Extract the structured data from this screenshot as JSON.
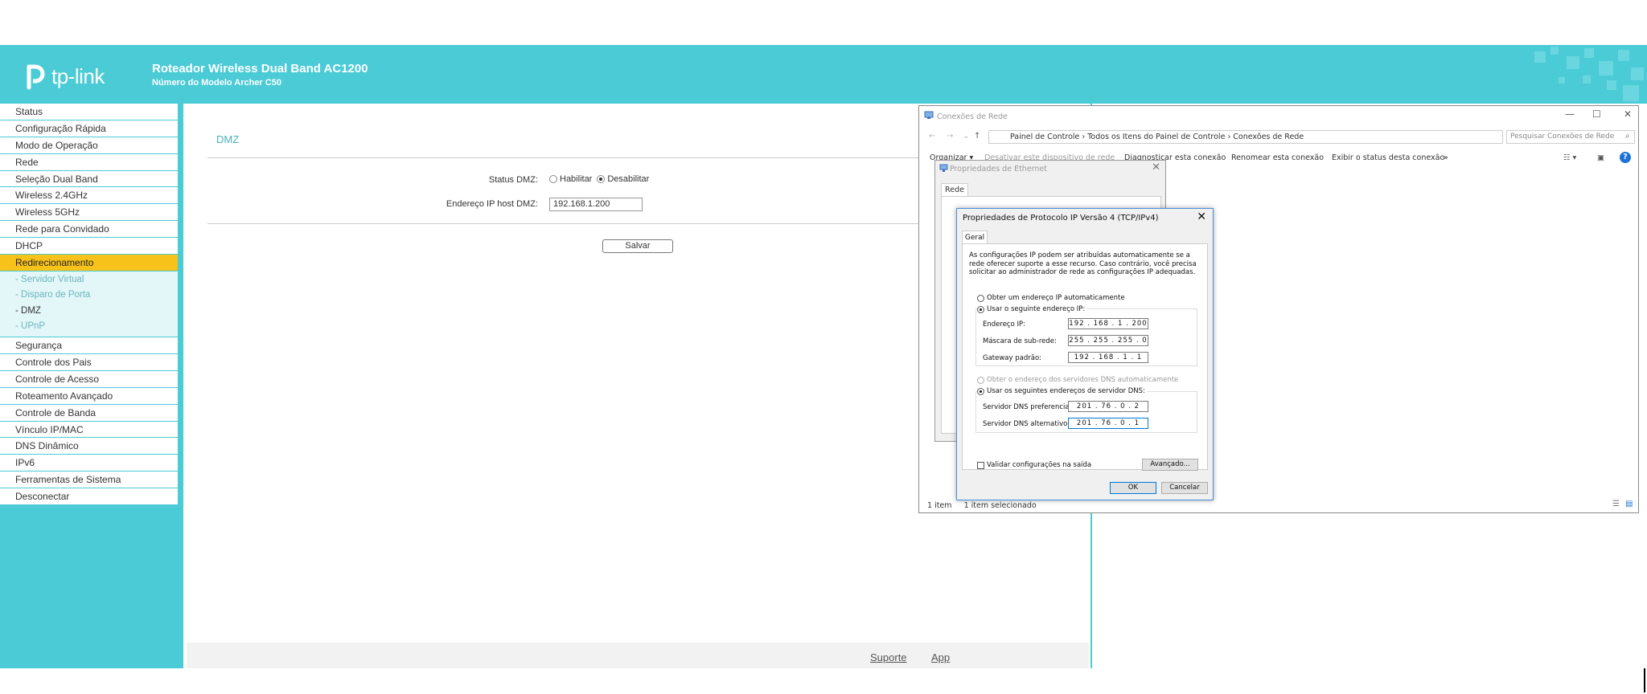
{
  "header": {
    "logo_text": "tp-link",
    "title": "Roteador Wireless Dual Band AC1200",
    "model": "Número do Modelo Archer C50"
  },
  "sidebar": {
    "items": [
      "Status",
      "Configuração Rápida",
      "Modo de Operação",
      "Rede",
      "Seleção Dual Band",
      "Wireless 2.4GHz",
      "Wireless 5GHz",
      "Rede para Convidado",
      "DHCP",
      "Redirecionamento",
      "Segurança",
      "Controle dos Pais",
      "Controle de Acesso",
      "Roteamento Avançado",
      "Controle de Banda",
      "Vínculo IP/MAC",
      "DNS Dinâmico",
      "IPv6",
      "Ferramentas de Sistema",
      "Desconectar"
    ],
    "active": "Redirecionamento",
    "sub_items": [
      "- Servidor Virtual",
      "- Disparo de Porta",
      "- DMZ",
      "- UPnP"
    ],
    "current_sub": "- DMZ"
  },
  "main": {
    "title": "DMZ",
    "status_label": "Status DMZ:",
    "enable_label": "Habilitar",
    "disable_label": "Desabilitar",
    "selected_status": "Desabilitar",
    "host_ip_label": "Endereço IP host DMZ:",
    "host_ip_value": "192.168.1.200",
    "save_label": "Salvar"
  },
  "footer": {
    "support": "Suporte",
    "app": "App"
  },
  "explorer": {
    "title": "Conexões de Rede",
    "breadcrumb": [
      "Painel de Controle",
      "Todos os Itens do Painel de Controle",
      "Conexões de Rede"
    ],
    "search_placeholder": "Pesquisar Conexões de Rede",
    "toolbar": [
      "Organizar ▾",
      "Desativar este dispositivo de rede",
      "Diagnosticar esta conexão",
      "Renomear esta conexão",
      "Exibir o status desta conexão",
      "»"
    ],
    "status_count": "1 item",
    "status_selected": "1 item selecionado"
  },
  "ethernet": {
    "title": "Propriedades de Ethernet",
    "tab": "Rede"
  },
  "ipv4": {
    "title": "Propriedades de Protocolo IP Versão 4 (TCP/IPv4)",
    "tab": "Geral",
    "description": "As configurações IP podem ser atribuídas automaticamente se a rede oferecer suporte a esse recurso. Caso contrário, você precisa solicitar ao administrador de rede as configurações IP adequadas.",
    "auto_ip": "Obter um endereço IP automaticamente",
    "manual_ip": "Usar o seguinte endereço IP:",
    "ip_label": "Endereço IP:",
    "ip_value": "192 . 168 .  1  . 200",
    "mask_label": "Máscara de sub-rede:",
    "mask_value": "255 . 255 . 255 .  0",
    "gateway_label": "Gateway padrão:",
    "gateway_value": "192 . 168 .  1  .  1",
    "auto_dns": "Obter o endereço dos servidores DNS automaticamente",
    "manual_dns": "Usar os seguintes endereços de servidor DNS:",
    "dns1_label": "Servidor DNS preferencial:",
    "dns1_value": "201 .  76  .  0  .  2",
    "dns2_label": "Servidor DNS alternativo:",
    "dns2_value": "201 .  76  .  0  .  1",
    "validate_label": "Validar configurações na saída",
    "advanced_label": "Avançado...",
    "ok_label": "OK",
    "cancel_label": "Cancelar"
  },
  "colors": {
    "brand": "#4acbd6",
    "active": "#f7c21a"
  }
}
